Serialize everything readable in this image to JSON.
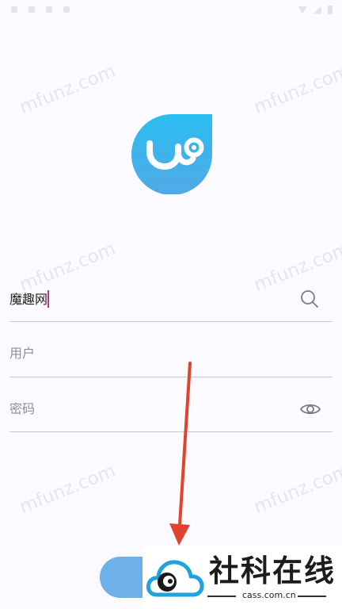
{
  "watermark": "mfunz.com",
  "app": {
    "logo_icon": "stethoscope-drop-logo",
    "brand_colors": {
      "logo_top": "#2bbdf1",
      "logo_bottom": "#52a9e6",
      "accent": "#d02f6a",
      "button": "#6eb1ea"
    }
  },
  "form": {
    "server_value": "魔趣网",
    "username_placeholder": "用户",
    "password_placeholder": "密码",
    "search_icon": "search-icon",
    "visibility_icon": "eye-icon"
  },
  "overlay": {
    "badge_title": "社科在线",
    "badge_sub": "cass.com.cn",
    "arrow_color": "#e0432f"
  }
}
